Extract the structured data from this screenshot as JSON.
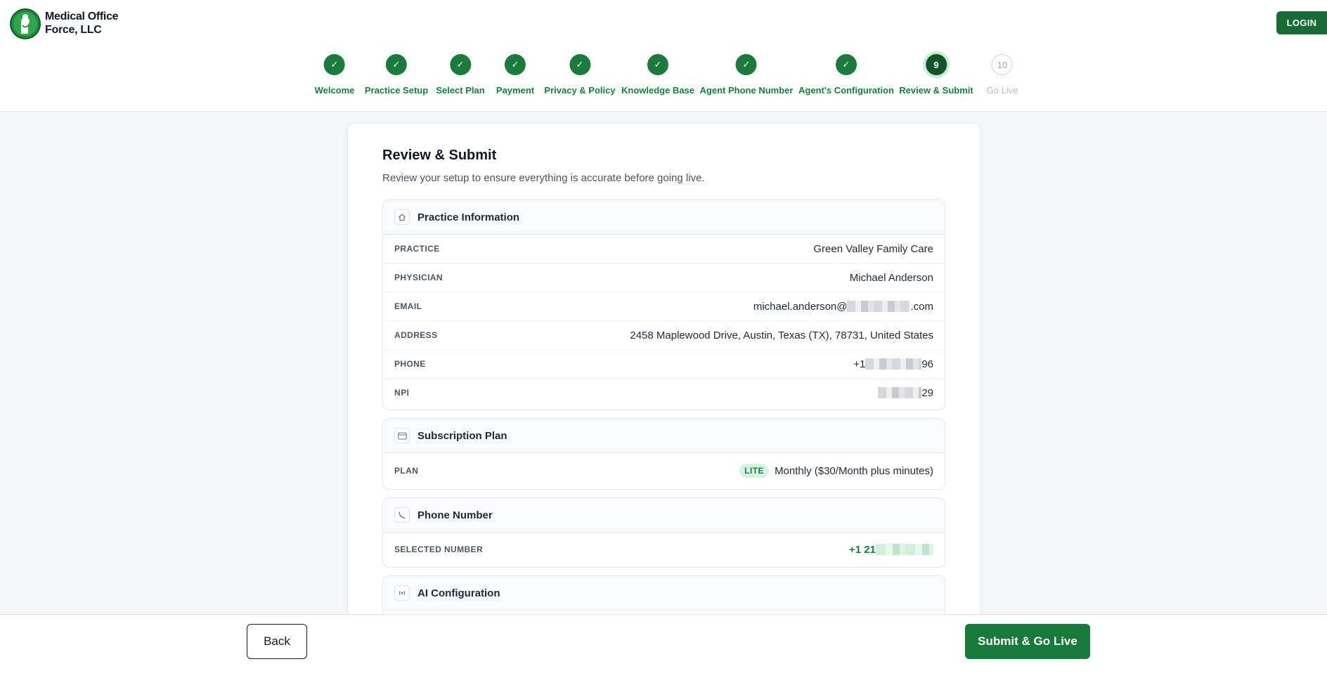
{
  "header": {
    "brand_line1": "Medical Office",
    "brand_line2": "Force, LLC",
    "login_label": "LOGIN"
  },
  "colors": {
    "accent": "#177a3a",
    "accent_light": "#d6f3e1"
  },
  "stepper": {
    "steps": [
      {
        "marker": "✓",
        "label": "Welcome",
        "state": "done"
      },
      {
        "marker": "✓",
        "label": "Practice Setup",
        "state": "done"
      },
      {
        "marker": "✓",
        "label": "Select Plan",
        "state": "done"
      },
      {
        "marker": "✓",
        "label": "Payment",
        "state": "done"
      },
      {
        "marker": "✓",
        "label": "Privacy & Policy",
        "state": "done"
      },
      {
        "marker": "✓",
        "label": "Knowledge Base",
        "state": "done"
      },
      {
        "marker": "✓",
        "label": "Agent Phone Number",
        "state": "done"
      },
      {
        "marker": "✓",
        "label": "Agent's Configuration",
        "state": "done"
      },
      {
        "marker": "9",
        "label": "Review & Submit",
        "state": "current"
      },
      {
        "marker": "10",
        "label": "Go Live",
        "state": "todo"
      }
    ]
  },
  "main": {
    "title": "Review & Submit",
    "subtitle": "Review your setup to ensure everything is accurate before going live."
  },
  "practice": {
    "title": "Practice Information",
    "icon": "home-icon",
    "practice_label": "PRACTICE",
    "practice_value": "Green Valley Family Care",
    "physician_label": "PHYSICIAN",
    "physician_value": "Michael Anderson",
    "email_label": "EMAIL",
    "email_prefix": "michael.anderson@",
    "email_suffix": ".com",
    "address_label": "ADDRESS",
    "address_value": "2458 Maplewood Drive, Austin, Texas (TX), 78731, United States",
    "phone_label": "PHONE",
    "phone_prefix": "+1",
    "phone_suffix": "96",
    "npi_label": "NPI",
    "npi_suffix": "29"
  },
  "subscription": {
    "title": "Subscription Plan",
    "icon": "credit-card-icon",
    "plan_label": "PLAN",
    "plan_badge": "LITE",
    "plan_value": "Monthly ($30/Month plus minutes)"
  },
  "phone_section": {
    "title": "Phone Number",
    "icon": "phone-icon",
    "selected_label": "SELECTED NUMBER",
    "selected_prefix": "+1 21"
  },
  "ai_section": {
    "title": "AI Configuration",
    "icon": "broadcast-icon"
  },
  "footer": {
    "back_label": "Back",
    "submit_label": "Submit & Go Live"
  }
}
